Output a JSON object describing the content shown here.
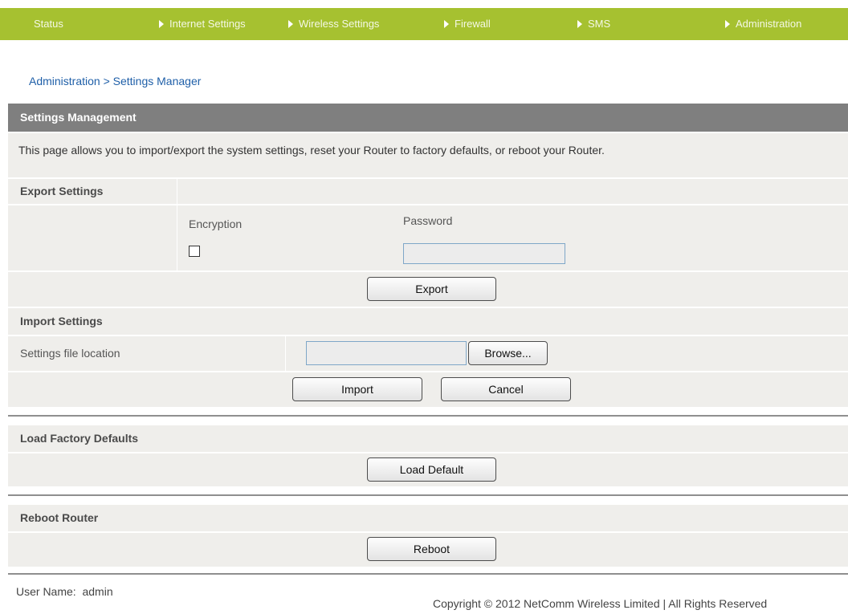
{
  "nav": {
    "items": [
      {
        "label": "Status"
      },
      {
        "label": "Internet Settings"
      },
      {
        "label": "Wireless Settings"
      },
      {
        "label": "Firewall"
      },
      {
        "label": "SMS"
      },
      {
        "label": "Administration"
      }
    ]
  },
  "breadcrumb": "Administration > Settings Manager",
  "settings_management": {
    "title": "Settings Management",
    "description": "This page allows you to import/export the system settings, reset your Router to factory defaults, or reboot your Router."
  },
  "export": {
    "header": "Export Settings",
    "encryption_label": "Encryption",
    "encryption_checked": false,
    "password_label": "Password",
    "password_value": "",
    "button": "Export"
  },
  "import": {
    "header": "Import Settings",
    "file_label": "Settings file location",
    "file_value": "",
    "browse_button": "Browse...",
    "import_button": "Import",
    "cancel_button": "Cancel"
  },
  "factory": {
    "header": "Load Factory Defaults",
    "button": "Load Default"
  },
  "reboot": {
    "header": "Reboot Router",
    "button": "Reboot"
  },
  "footer": {
    "user_label": "User Name:",
    "user_value": "admin",
    "copyright": "Copyright © 2012 NetComm Wireless Limited | All Rights Reserved"
  },
  "colors": {
    "nav_bg": "#a6c130",
    "section_title_bg": "#7f7f7f",
    "panel_bg": "#efeeeb",
    "link": "#1f5fa8"
  }
}
